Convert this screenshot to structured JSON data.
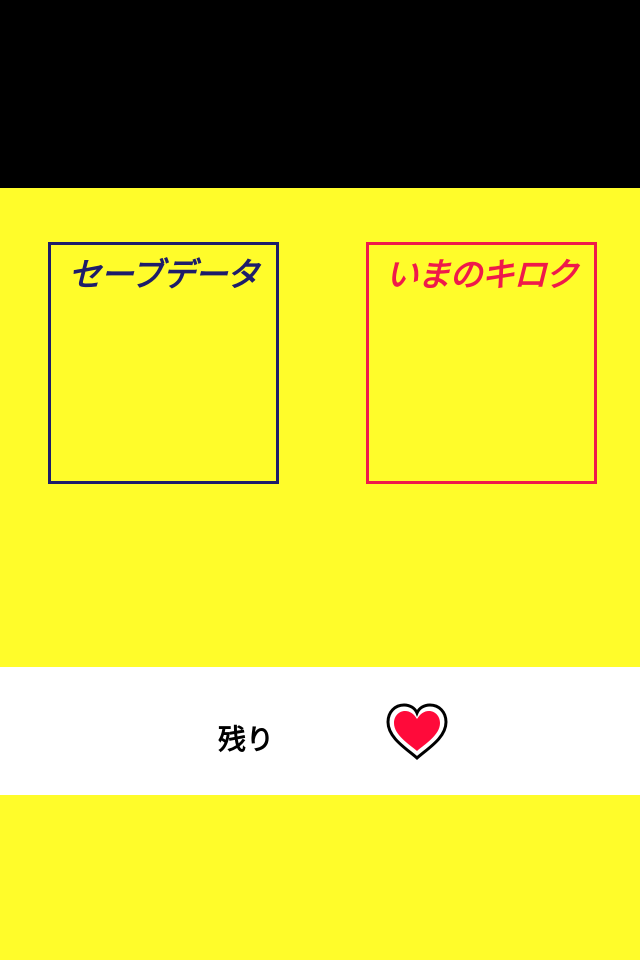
{
  "save_panel": {
    "title": "セーブデータ",
    "border_color": "#1e1d6a"
  },
  "record_panel": {
    "title": "いまのキロク",
    "border_color": "#ef1a4a"
  },
  "status": {
    "remaining_label": "残り",
    "lives_icon": "heart-icon",
    "heart_color": "#ff0a3a"
  },
  "colors": {
    "background": "#fffc2a",
    "top_bar": "#000000",
    "status_bar": "#ffffff"
  }
}
